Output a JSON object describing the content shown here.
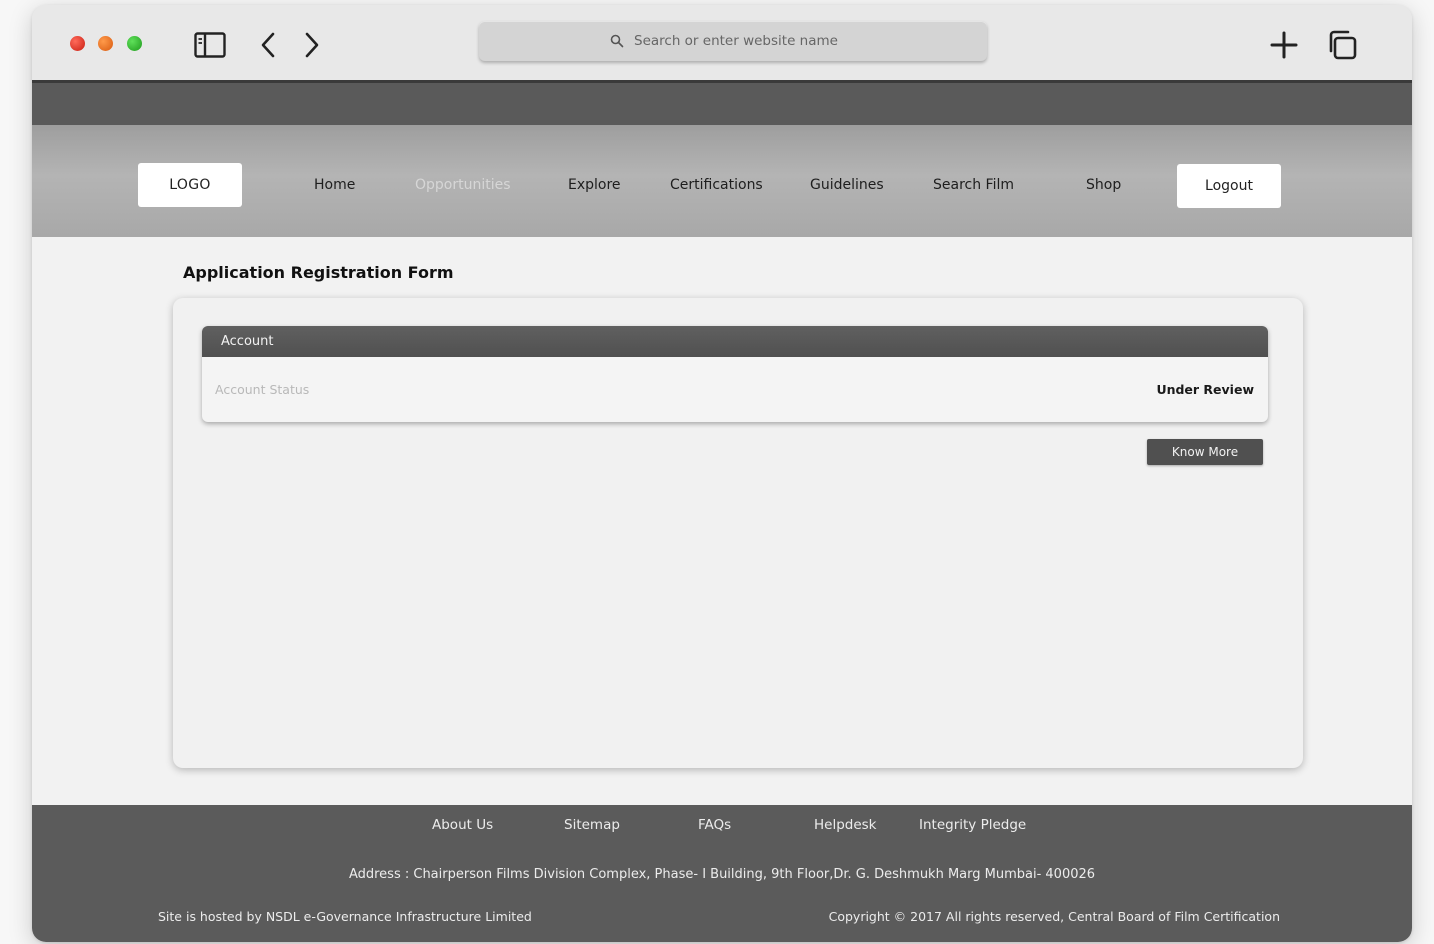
{
  "browser": {
    "address_placeholder": "Search or enter website name",
    "icons": [
      "sidebar-toggle-icon",
      "back-chevron-icon",
      "forward-chevron-icon",
      "search-icon",
      "new-tab-plus-icon",
      "tabs-overview-icon"
    ],
    "traffic_light_colors": [
      "#e0261a",
      "#ee6a22",
      "#2fb52a"
    ]
  },
  "nav": {
    "logo": "LOGO",
    "items": [
      {
        "label": "Home"
      },
      {
        "label": "Opportunities"
      },
      {
        "label": "Explore"
      },
      {
        "label": "Certifications"
      },
      {
        "label": "Guidelines"
      },
      {
        "label": "Search Film"
      },
      {
        "label": "Shop"
      }
    ],
    "active_item": "Opportunities",
    "logout_label": "Logout"
  },
  "page": {
    "title": "Application Registration Form",
    "account": {
      "header": "Account",
      "status_label": "Account Status",
      "status_value": "Under Review"
    },
    "know_more_label": "Know More"
  },
  "footer": {
    "links": [
      "About Us",
      "Sitemap",
      "FAQs",
      "Helpdesk",
      "Integrity Pledge"
    ],
    "address": "Address :  Chairperson Films Division Complex, Phase- I Building, 9th Floor,Dr. G. Deshmukh Marg Mumbai- 400026",
    "hosted": "Site is hosted by NSDL e-Governance Infrastructure Limited",
    "copyright": "Copyright © 2017 All rights reserved, Central Board of Film Certification"
  },
  "colors": {
    "dark_band": "#5a5a5a",
    "nav_bg": "#a8a8a8",
    "footer_bg": "#5b5b5b",
    "button_dark": "#505050"
  }
}
